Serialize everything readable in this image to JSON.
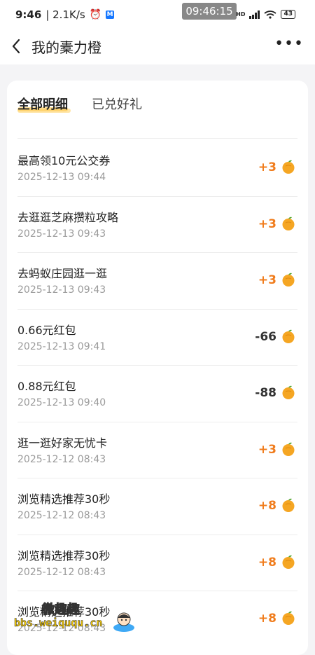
{
  "status_bar": {
    "time": "9:46",
    "net_speed": "| 2.1K/s",
    "overlay_time": "09:46:15",
    "hd_label": "HD",
    "battery": "43"
  },
  "header": {
    "title": "我的橐力橙"
  },
  "tabs": [
    {
      "label": "全部明细",
      "active": true
    },
    {
      "label": "已兑好礼",
      "active": false
    }
  ],
  "records": [
    {
      "title": "最高领10元公交券",
      "time": "2025-12-13 09:44",
      "amount": "+3"
    },
    {
      "title": "去逛逛芝麻攒粒攻略",
      "time": "2025-12-13 09:43",
      "amount": "+3"
    },
    {
      "title": "去蚂蚁庄园逛一逛",
      "time": "2025-12-13 09:43",
      "amount": "+3"
    },
    {
      "title": "0.66元红包",
      "time": "2025-12-13 09:41",
      "amount": "-66"
    },
    {
      "title": "0.88元红包",
      "time": "2025-12-13 09:40",
      "amount": "-88"
    },
    {
      "title": "逛一逛好家无忧卡",
      "time": "2025-12-12 08:43",
      "amount": "+3"
    },
    {
      "title": "浏览精选推荐30秒",
      "time": "2025-12-12 08:43",
      "amount": "+8"
    },
    {
      "title": "浏览精选推荐30秒",
      "time": "2025-12-12 08:43",
      "amount": "+8"
    },
    {
      "title": "浏览精选推荐30秒",
      "time": "2025-12-12 08:43",
      "amount": "+8"
    }
  ],
  "watermark": {
    "title": "微趣趣",
    "url": "bbs.weiququ.cn"
  },
  "colors": {
    "positive": "#f07c1c",
    "negative": "#333333",
    "orange_icon": "#f5a623"
  }
}
